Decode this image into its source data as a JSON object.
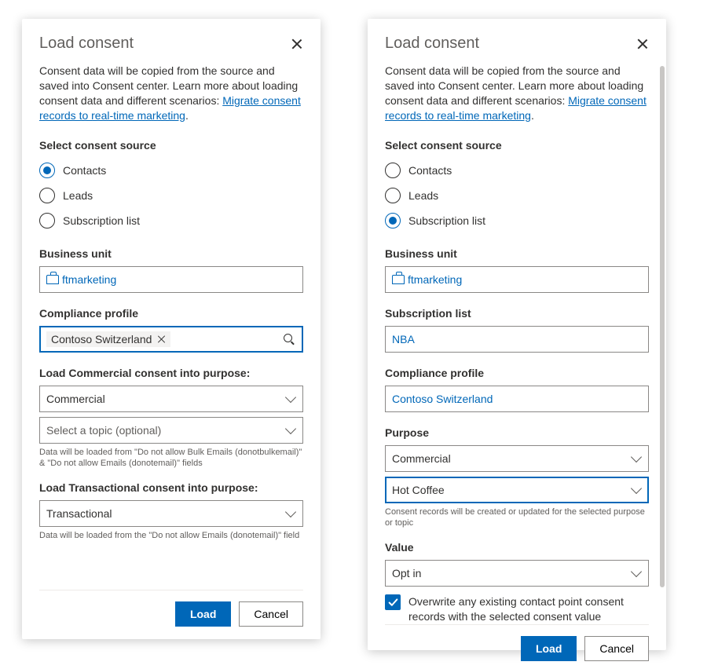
{
  "left": {
    "title": "Load consent",
    "intro_pre": "Consent data will be copied from the source and saved into Consent center. Learn more about loading consent data and different scenarios: ",
    "intro_link": "Migrate consent records to real-time marketing",
    "intro_post": ".",
    "select_source_label": "Select consent source",
    "radios": {
      "contacts": "Contacts",
      "leads": "Leads",
      "sublist": "Subscription list"
    },
    "selected_radio": "contacts",
    "bu_label": "Business unit",
    "bu_value": "ftmarketing",
    "profile_label": "Compliance profile",
    "profile_tag": "Contoso Switzerland",
    "commercial_label": "Load Commercial consent into purpose:",
    "commercial_value": "Commercial",
    "topic_placeholder": "Select a topic (optional)",
    "commercial_hint": "Data will be loaded from \"Do not allow Bulk Emails (donotbulkemail)\" & \"Do not allow Emails (donotemail)\" fields",
    "transactional_label": "Load Transactional consent into purpose:",
    "transactional_value": "Transactional",
    "transactional_hint": "Data will be loaded from the \"Do not allow Emails (donotemail)\" field",
    "load_btn": "Load",
    "cancel_btn": "Cancel"
  },
  "right": {
    "title": "Load consent",
    "intro_pre": "Consent data will be copied from the source and saved into Consent center. Learn more about loading consent data and different scenarios: ",
    "intro_link": "Migrate consent records to real-time marketing",
    "intro_post": ".",
    "select_source_label": "Select consent source",
    "radios": {
      "contacts": "Contacts",
      "leads": "Leads",
      "sublist": "Subscription list"
    },
    "selected_radio": "sublist",
    "bu_label": "Business unit",
    "bu_value": "ftmarketing",
    "sublist_label": "Subscription list",
    "sublist_value": "NBA",
    "profile_label": "Compliance profile",
    "profile_value": "Contoso Switzerland",
    "purpose_label": "Purpose",
    "purpose_value": "Commercial",
    "topic_value": "Hot Coffee",
    "purpose_hint": "Consent records will be created or updated for the selected purpose or topic",
    "value_label": "Value",
    "value_value": "Opt in",
    "overwrite_label": "Overwrite any existing contact point consent records with the selected consent value",
    "load_btn": "Load",
    "cancel_btn": "Cancel"
  }
}
